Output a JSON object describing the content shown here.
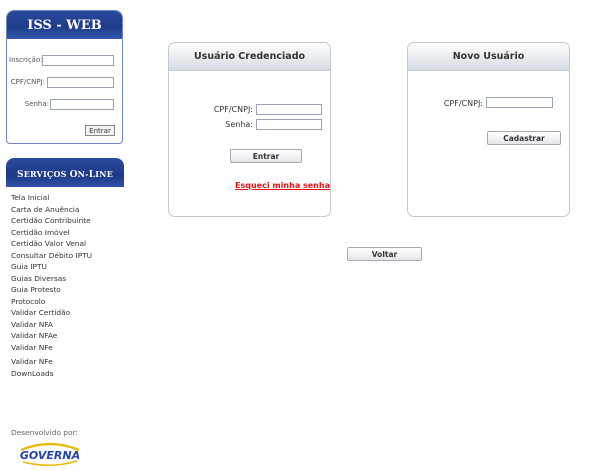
{
  "login": {
    "title": "ISS - WEB",
    "inscricao_label": "Inscrição:",
    "cpf_label": "CPF/CNPJ:",
    "senha_label": "Senha:",
    "submit_label": "Entrar"
  },
  "services": {
    "title_first_big": "S",
    "title_first_rest": "ERVIÇOS ",
    "title_second_big": "O",
    "title_second_rest": "N-",
    "title_third_big": "L",
    "title_third_rest": "INE",
    "items": [
      "Tela Inicial",
      "Carta de Anuência",
      "Certidão Contribuinte",
      "Certidão Imóvel",
      "Certidão Valor Venal",
      "Consultar Débito IPTU",
      "Guia IPTU",
      "Guias Diversas",
      "Guia Protesto",
      "Protocolo",
      "Validar Certidão",
      "Validar NFA",
      "Validar NFAe",
      "Validar NFe",
      "Validar NFe",
      "DownLoads"
    ]
  },
  "footer": {
    "developed_by": "Desenvolvido por:",
    "logo_text": "GOVERNA"
  },
  "credenciado": {
    "title": "Usuário  Credenciado",
    "cpf_label": "CPF/CNPJ:",
    "senha_label": "Senha:",
    "submit_label": "Entrar",
    "forgot_label": "Esqueci minha senha"
  },
  "novo": {
    "title": "Novo  Usuário",
    "cpf_label": "CPF/CNPJ:",
    "submit_label": "Cadastrar"
  },
  "back_label": "Voltar"
}
